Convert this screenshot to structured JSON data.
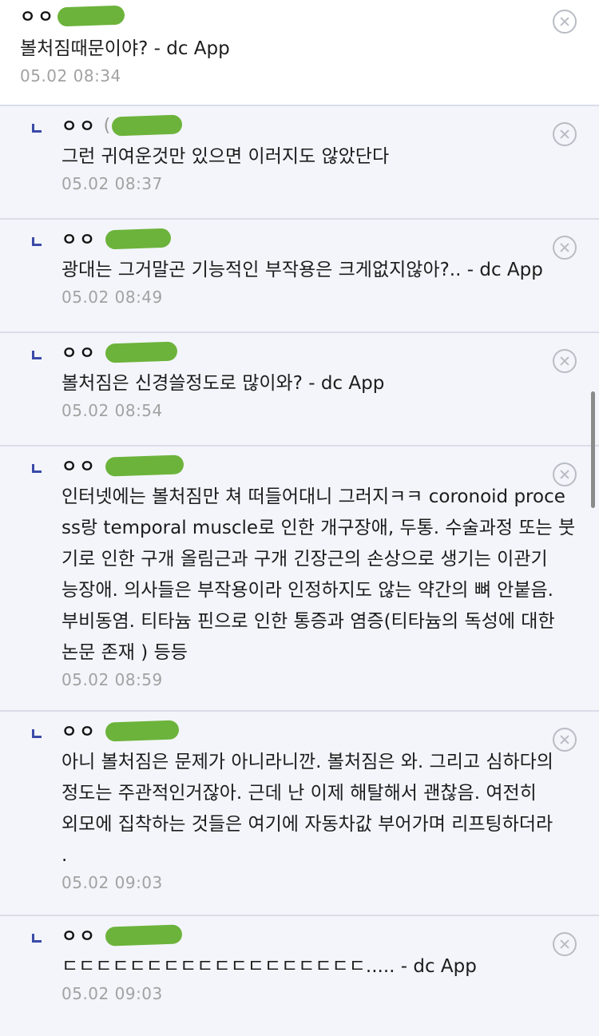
{
  "comments": [
    {
      "author": "ㅇㅇ",
      "paren": "",
      "text": "볼처짐때문이야? - dc App",
      "date": "05.02 08:34",
      "reply": false
    },
    {
      "author": "ㅇㅇ",
      "paren": "(",
      "text": "그런 귀여운것만 있으면 이러지도 않았단다",
      "date": "05.02 08:37",
      "reply": true
    },
    {
      "author": "ㅇㅇ",
      "paren": "",
      "text": "광대는 그거말곤 기능적인 부작용은 크게없지않아?.. - dc App",
      "date": "05.02 08:49",
      "reply": true
    },
    {
      "author": "ㅇㅇ",
      "paren": "",
      "text": "볼처짐은 신경쓸정도로 많이와? - dc App",
      "date": "05.02 08:54",
      "reply": true
    },
    {
      "author": "ㅇㅇ",
      "paren": "",
      "text": "인터넷에는 볼처짐만 쳐 떠들어대니 그러지ㅋㅋ coronoid proce\nss랑 temporal muscle로 인한 개구장애, 두통. 수술과정 또는 붓\n기로 인한 구개 올림근과 구개 긴장근의 손상으로 생기는 이관기\n능장애. 의사들은 부작용이라 인정하지도 않는 약간의 뼈 안붙음.\n부비동염. 티타늄 핀으로 인한 통증과 염증(티타늄의 독성에 대한\n논문 존재 ) 등등",
      "date": "05.02 08:59",
      "reply": true
    },
    {
      "author": "ㅇㅇ",
      "paren": "",
      "text": "아니 볼처짐은 문제가 아니라니깐. 볼처짐은 와. 그리고 심하다의\n정도는 주관적인거잖아. 근데 난 이제 해탈해서 괜찮음. 여전히\n외모에 집착하는 것들은 여기에 자동차값 부어가며 리프팅하더라\n.",
      "date": "05.02 09:03",
      "reply": true
    },
    {
      "author": "ㅇㅇ",
      "paren": "",
      "text": "ㄷㄷㄷㄷㄷㄷㄷㄷㄷㄷㄷㄷㄷㄷㄷㄷㄷㄷ..... - dc App",
      "date": "05.02 09:03",
      "reply": true
    }
  ],
  "colors": {
    "reply_bg": "#f3f5fa",
    "redaction": "#6cb33b",
    "reply_mark": "#3b4aa8"
  },
  "icons": {
    "delete": "close-circle-icon",
    "reply": "reply-arrow-icon"
  }
}
